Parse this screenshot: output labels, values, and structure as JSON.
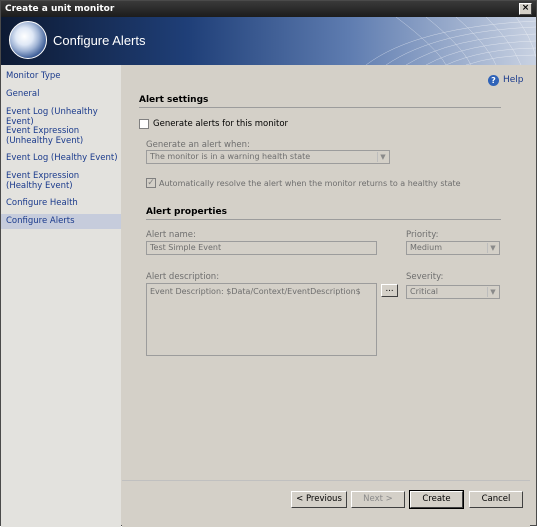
{
  "window": {
    "title": "Create a unit monitor",
    "close_glyph": "×"
  },
  "banner": {
    "title": "Configure Alerts"
  },
  "nav": {
    "items": [
      {
        "label": "Monitor Type"
      },
      {
        "label": "General"
      },
      {
        "label": "Event Log (Unhealthy Event)"
      },
      {
        "label": "Event Expression (Unhealthy Event)"
      },
      {
        "label": "Event Log (Healthy Event)"
      },
      {
        "label": "Event Expression (Healthy Event)"
      },
      {
        "label": "Configure Health"
      },
      {
        "label": "Configure Alerts",
        "selected": true
      }
    ]
  },
  "help": {
    "icon": "help-icon",
    "label": "Help"
  },
  "alert_settings": {
    "heading": "Alert settings",
    "generate_checkbox_label": "Generate alerts for this monitor",
    "generate_checked": false,
    "generate_when_label": "Generate an alert when:",
    "generate_when_value": "The monitor is in a warning health state",
    "auto_resolve_label": "Automatically resolve the alert when the monitor returns to a healthy state",
    "auto_resolve_checked": true,
    "auto_resolve_mark": "✓"
  },
  "alert_properties": {
    "heading": "Alert properties",
    "name_label": "Alert name:",
    "name_value": "Test Simple Event",
    "priority_label": "Priority:",
    "priority_value": "Medium",
    "description_label": "Alert description:",
    "description_value": "Event Description: $Data/Context/EventDescription$",
    "ellipsis_label": "...",
    "severity_label": "Severity:",
    "severity_value": "Critical",
    "dropdown_glyph": "▼"
  },
  "footer": {
    "previous_label": "< Previous",
    "next_label": "Next >",
    "create_label": "Create",
    "cancel_label": "Cancel"
  }
}
